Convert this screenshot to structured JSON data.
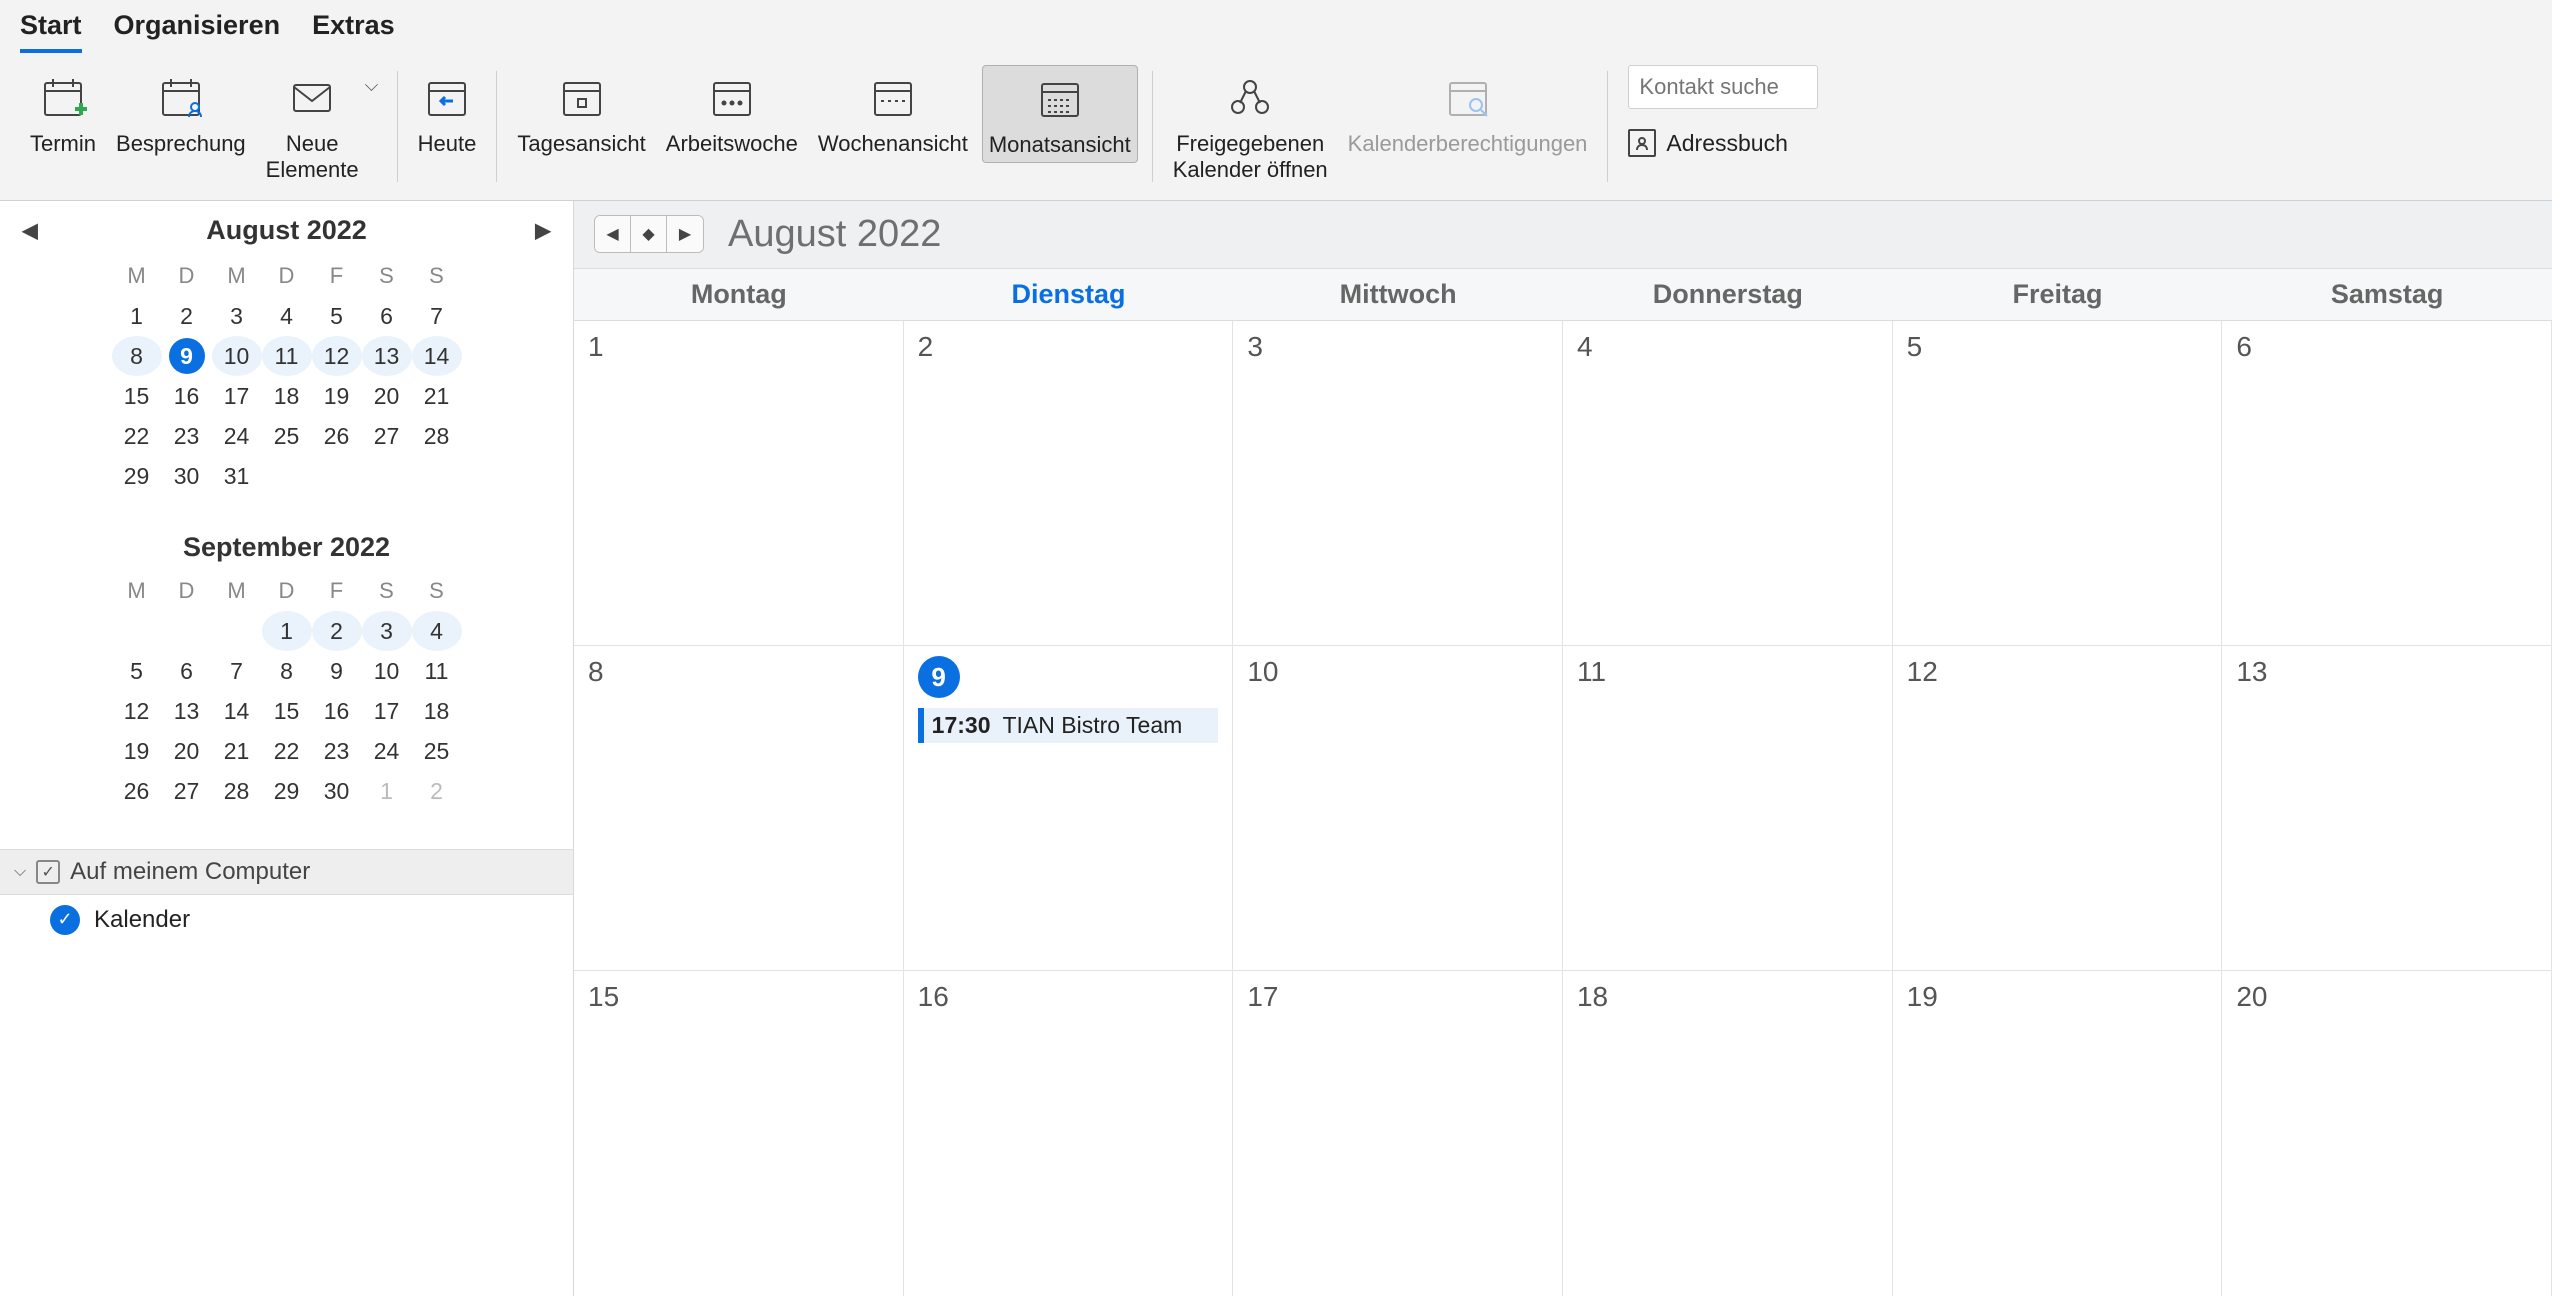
{
  "tabs": {
    "start": "Start",
    "organisieren": "Organisieren",
    "extras": "Extras"
  },
  "ribbon": {
    "termin": "Termin",
    "besprechung": "Besprechung",
    "neue_elemente": "Neue\nElemente",
    "heute": "Heute",
    "tagesansicht": "Tagesansicht",
    "arbeitswoche": "Arbeitswoche",
    "wochenansicht": "Wochenansicht",
    "monatsansicht": "Monatsansicht",
    "freigegebenen": "Freigegebenen\nKalender öffnen",
    "kalenderberechtigungen": "Kalenderberechtigungen",
    "search_placeholder": "Kontakt suche",
    "adressbuch": "Adressbuch"
  },
  "mini": {
    "month1_title": "August 2022",
    "month2_title": "September 2022",
    "dow": [
      "M",
      "D",
      "M",
      "D",
      "F",
      "S",
      "S"
    ],
    "month1_days": [
      1,
      2,
      3,
      4,
      5,
      6,
      7,
      8,
      9,
      10,
      11,
      12,
      13,
      14,
      15,
      16,
      17,
      18,
      19,
      20,
      21,
      22,
      23,
      24,
      25,
      26,
      27,
      28,
      29,
      30,
      31
    ],
    "month1_today": 9,
    "month1_week_hl_start": 8,
    "month1_week_hl_end": 14,
    "month2_leading": [
      1,
      2,
      3,
      4
    ],
    "month2_days": [
      5,
      6,
      7,
      8,
      9,
      10,
      11,
      12,
      13,
      14,
      15,
      16,
      17,
      18,
      19,
      20,
      21,
      22,
      23,
      24,
      25,
      26,
      27,
      28,
      29,
      30
    ],
    "month2_trailing": [
      1,
      2
    ]
  },
  "sidebar": {
    "section": "Auf meinem Computer",
    "calendar": "Kalender"
  },
  "main": {
    "title": "August 2022",
    "weekdays": [
      "Montag",
      "Dienstag",
      "Mittwoch",
      "Donnerstag",
      "Freitag",
      "Samstag"
    ],
    "accent_index": 1,
    "cells": [
      {
        "n": "1"
      },
      {
        "n": "2"
      },
      {
        "n": "3"
      },
      {
        "n": "4"
      },
      {
        "n": "5"
      },
      {
        "n": "6"
      },
      {
        "n": "8"
      },
      {
        "n": "9",
        "today": true,
        "event": {
          "time": "17:30",
          "title": "TIAN Bistro Team"
        }
      },
      {
        "n": "10"
      },
      {
        "n": "11"
      },
      {
        "n": "12"
      },
      {
        "n": "13"
      },
      {
        "n": "15"
      },
      {
        "n": "16"
      },
      {
        "n": "17"
      },
      {
        "n": "18"
      },
      {
        "n": "19"
      },
      {
        "n": "20"
      }
    ]
  }
}
